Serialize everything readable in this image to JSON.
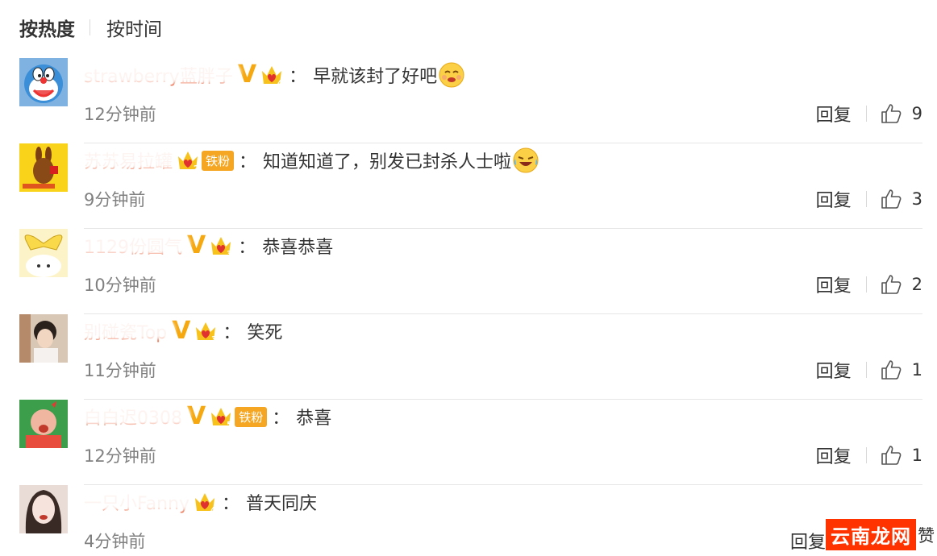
{
  "tabs": [
    {
      "label": "按热度",
      "active": true
    },
    {
      "label": "按时间",
      "active": false
    }
  ],
  "comments": [
    {
      "username": "strawberry蓝胖子",
      "verified": "V",
      "fan_level": "4",
      "fan_tag": "",
      "text": "早就该封了好吧",
      "emoji": "smile-emoji",
      "time": "12分钟前",
      "reply_label": "回复",
      "likes": "9"
    },
    {
      "username": "苏苏易拉罐",
      "verified": "",
      "fan_level": "2",
      "fan_tag": "铁粉",
      "text": "知道知道了，别发已封杀人士啦",
      "emoji": "laugh-cry-emoji",
      "time": "9分钟前",
      "reply_label": "回复",
      "likes": "3"
    },
    {
      "username": "1129份圆气",
      "verified": "V",
      "fan_level": "3",
      "fan_tag": "",
      "text": "恭喜恭喜",
      "emoji": "",
      "time": "10分钟前",
      "reply_label": "回复",
      "likes": "2"
    },
    {
      "username": "别碰瓷Top",
      "verified": "V",
      "fan_level": "3",
      "fan_tag": "",
      "text": "笑死",
      "emoji": "",
      "time": "11分钟前",
      "reply_label": "回复",
      "likes": "1"
    },
    {
      "username": "白白迟0308",
      "verified": "V",
      "fan_level": "5",
      "fan_tag": "铁粉",
      "text": "恭喜",
      "emoji": "",
      "time": "12分钟前",
      "reply_label": "回复",
      "likes": "1"
    },
    {
      "username": "一只小Fanny",
      "verified": "",
      "fan_level": "4",
      "fan_tag": "",
      "text": "普天同庆",
      "emoji": "",
      "time": "4分钟前",
      "reply_label": "回复",
      "likes": ""
    }
  ],
  "separator": "：",
  "watermark": {
    "box": "云南龙网",
    "tail": "赞"
  },
  "colors": {
    "username": "#eb7350",
    "vbadge": "#f6a811",
    "time": "#808080",
    "divider": "#e6e6e6",
    "watermark": "#ff3300"
  }
}
